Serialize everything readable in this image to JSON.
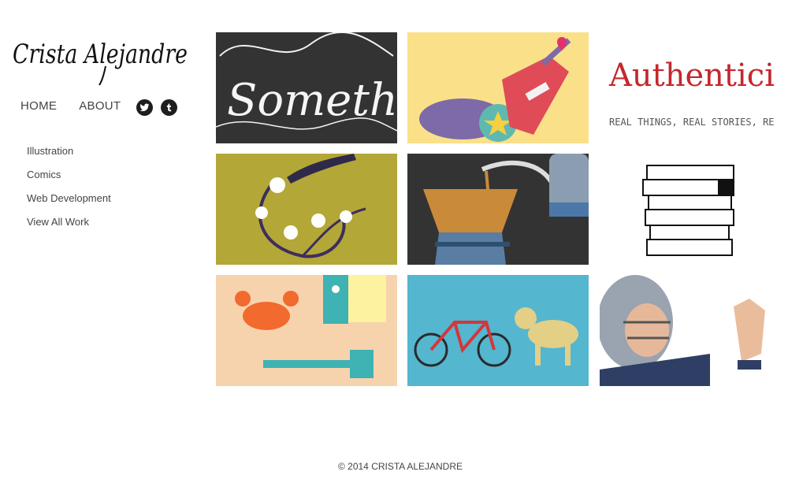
{
  "brand": {
    "logo_text": "Crista Alejandre"
  },
  "nav": {
    "home": "HOME",
    "about": "ABOUT"
  },
  "social": [
    {
      "icon": "twitter-icon"
    },
    {
      "icon": "tumblr-icon"
    }
  ],
  "categories": [
    "Illustration",
    "Comics",
    "Web Development",
    "View All Work"
  ],
  "portfolio": {
    "tile1_text": "Someth",
    "tile3_title": "Authentici",
    "tile3_subtitle": "REAL THINGS, REAL STORIES, RE"
  },
  "footer": {
    "copyright": "© 2014 CRISTA ALEJANDRE"
  },
  "colors": {
    "dark_tile": "#333333",
    "yellow_tile": "#fbe08a",
    "olive_tile": "#b3a737",
    "peach_tile": "#f7d3ad",
    "blue_tile": "#54b6cf",
    "red_text": "#c3282d"
  }
}
